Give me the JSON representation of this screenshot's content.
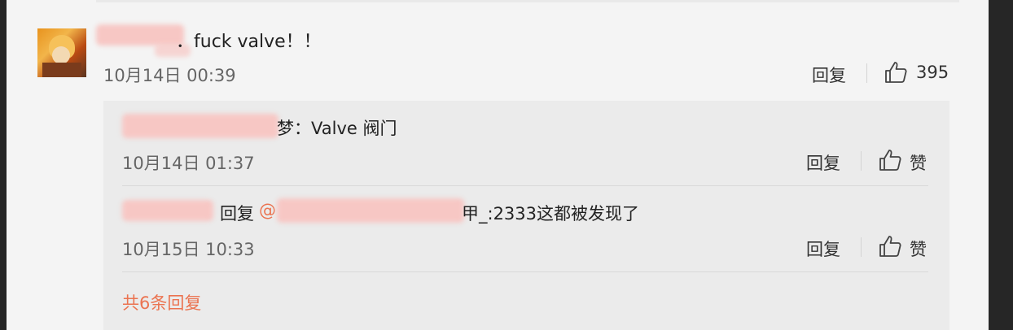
{
  "comment": {
    "text": "．fuck valve！！",
    "time": "10月14日 00:39",
    "reply_label": "回复",
    "like_count": "395"
  },
  "replies": [
    {
      "text": "梦：Valve 阀门",
      "time": "10月14日 01:37",
      "reply_label": "回复",
      "like_label": "赞"
    },
    {
      "prefix": "回复",
      "mention": "@",
      "suffix": "甲_:2333这都被发现了",
      "time": "10月15日 10:33",
      "reply_label": "回复",
      "like_label": "赞"
    }
  ],
  "total_replies_label": "共6条回复",
  "colors": {
    "link": "#eb7350",
    "redaction": "#f7c7c4",
    "reply_background": "#ebebeb"
  },
  "icons": [
    "thumbs-up-icon",
    "avatar-image"
  ]
}
